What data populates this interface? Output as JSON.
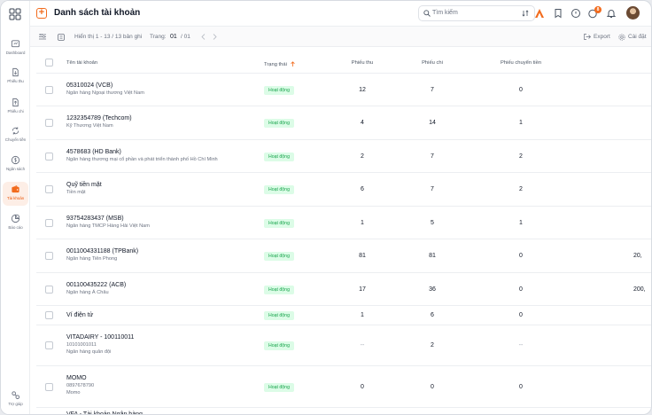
{
  "header": {
    "title": "Danh sách tài khoản",
    "search_placeholder": "Tìm kiếm",
    "notification_count": "8"
  },
  "sidebar": {
    "items": [
      {
        "label": "Dashboard",
        "icon": "dashboard-icon"
      },
      {
        "label": "Phiếu thu",
        "icon": "receipt-in-icon"
      },
      {
        "label": "Phiếu chi",
        "icon": "receipt-out-icon"
      },
      {
        "label": "Chuyển tiền",
        "icon": "transfer-icon"
      },
      {
        "label": "Ngân sách",
        "icon": "budget-icon"
      },
      {
        "label": "Tài khoản",
        "icon": "wallet-icon",
        "active": true
      },
      {
        "label": "Báo cáo",
        "icon": "report-icon"
      }
    ],
    "bottom_label": "Trợ giúp"
  },
  "toolbar": {
    "records": "Hiển thị 1 - 13 / 13 bản ghi",
    "page_label": "Trang:",
    "page_current": "01",
    "page_total": "/ 01",
    "export_label": "Export",
    "settings_label": "Cài đặt"
  },
  "table": {
    "columns": {
      "name": "Tên tài khoản",
      "status": "Trạng thái",
      "receipts": "Phiếu thu",
      "payments": "Phiếu chi",
      "transfers": "Phiếu chuyển tiền"
    },
    "rows": [
      {
        "name": "05310024 (VCB)",
        "lines": [
          "Ngân hàng Ngoại thương Việt Nam"
        ],
        "status": "Hoạt động",
        "receipts": "12",
        "payments": "7",
        "transfers": "0",
        "extra": ""
      },
      {
        "name": "1232354789 (Techcom)",
        "lines": [
          "Kỹ Thương Việt Nam"
        ],
        "status": "Hoạt động",
        "receipts": "4",
        "payments": "14",
        "transfers": "1",
        "extra": ""
      },
      {
        "name": "4578683 (HD Bank)",
        "lines": [
          "Ngân hàng thương mại cổ phần và phát triển thành phố Hồ Chí Minh"
        ],
        "status": "Hoạt động",
        "receipts": "2",
        "payments": "7",
        "transfers": "2",
        "extra": ""
      },
      {
        "name": "Quỹ tiền mặt",
        "lines": [
          "Tiền mặt"
        ],
        "status": "Hoạt động",
        "receipts": "6",
        "payments": "7",
        "transfers": "2",
        "extra": ""
      },
      {
        "name": "93754283437 (MSB)",
        "lines": [
          "Ngân hàng TMCP Hàng Hải Việt Nam"
        ],
        "status": "Hoạt động",
        "receipts": "1",
        "payments": "5",
        "transfers": "1",
        "extra": ""
      },
      {
        "name": "0011004331188 (TPBank)",
        "lines": [
          "Ngân hàng Tiên Phong"
        ],
        "status": "Hoạt động",
        "receipts": "81",
        "payments": "81",
        "transfers": "0",
        "extra": "20,"
      },
      {
        "name": "001100435222 (ACB)",
        "lines": [
          "Ngân hàng Á Châu"
        ],
        "status": "Hoạt động",
        "receipts": "17",
        "payments": "36",
        "transfers": "0",
        "extra": "200,"
      },
      {
        "name": "Ví điện tử",
        "lines": [],
        "status": "Hoạt động",
        "receipts": "1",
        "payments": "6",
        "transfers": "0",
        "extra": ""
      },
      {
        "name": "VITADAIRY - 100110011",
        "lines": [
          "10101001011",
          "Ngân hàng quân đội"
        ],
        "status": "Hoạt động",
        "receipts": "--",
        "payments": "2",
        "transfers": "--",
        "extra": ""
      },
      {
        "name": "MOMO",
        "lines": [
          "0897678790",
          "Momo"
        ],
        "status": "Hoạt động",
        "receipts": "0",
        "payments": "0",
        "transfers": "0",
        "extra": ""
      },
      {
        "name": "VFA - Tài khoản Ngân hàng",
        "lines": [],
        "status": "",
        "receipts": "",
        "payments": "",
        "transfers": "",
        "extra": ""
      }
    ]
  }
}
